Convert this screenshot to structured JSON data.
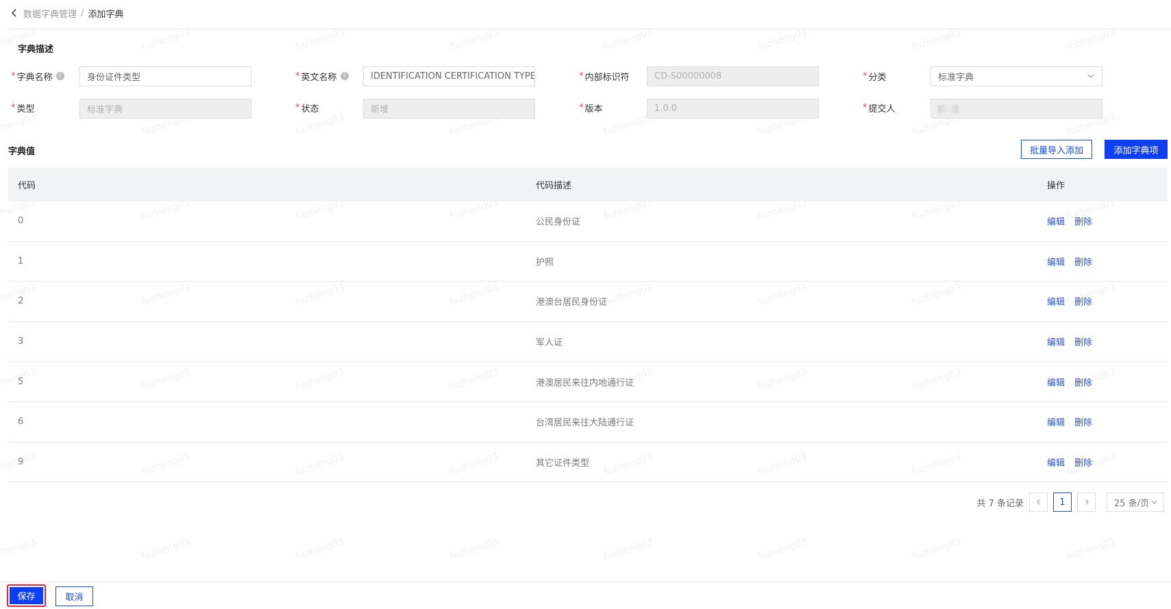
{
  "breadcrumb": {
    "parent": "数据字典管理",
    "separator": "/",
    "current": "添加字典"
  },
  "watermark": "fuzheng03",
  "description_section": {
    "title": "字典描述",
    "fields": {
      "dict_name": {
        "label": "字典名称",
        "value": "身份证件类型"
      },
      "english_name": {
        "label": "英文名称",
        "value": "IDENTIFICATION CERTIFICATION TYPE"
      },
      "internal_id": {
        "label": "内部标识符",
        "value": "CD-S00000008"
      },
      "category": {
        "label": "分类",
        "value": "标准字典"
      },
      "type": {
        "label": "类型",
        "value": "标准字典"
      },
      "status": {
        "label": "状态",
        "value": "新增"
      },
      "version": {
        "label": "版本",
        "value": "1.0.0"
      },
      "submitter": {
        "label": "提交人",
        "value": ""
      }
    },
    "required_mark": "*"
  },
  "values_section": {
    "title": "字典值",
    "batch_import_label": "批量导入添加",
    "add_item_label": "添加字典项",
    "columns": {
      "code": "代码",
      "desc": "代码描述",
      "ops": "操作"
    },
    "rows": [
      {
        "code": "0",
        "desc": "公民身份证",
        "edit": "编辑",
        "delete": "删除"
      },
      {
        "code": "1",
        "desc": "护照",
        "edit": "编辑",
        "delete": "删除"
      },
      {
        "code": "2",
        "desc": "港澳台居民身份证",
        "edit": "编辑",
        "delete": "删除"
      },
      {
        "code": "3",
        "desc": "军人证",
        "edit": "编辑",
        "delete": "删除"
      },
      {
        "code": "5",
        "desc": "港澳居民来往内地通行证",
        "edit": "编辑",
        "delete": "删除"
      },
      {
        "code": "6",
        "desc": "台湾居民来往大陆通行证",
        "edit": "编辑",
        "delete": "删除"
      },
      {
        "code": "9",
        "desc": "其它证件类型",
        "edit": "编辑",
        "delete": "删除"
      }
    ]
  },
  "pagination": {
    "total_text": "共 7 条记录",
    "current_page": "1",
    "page_size": "25 条/页"
  },
  "footer": {
    "save_label": "保存",
    "cancel_label": "取消"
  },
  "colors": {
    "primary": "#0f3ff5",
    "required": "#e34d59",
    "link": "#2f55d8",
    "highlight_border": "#e0243a"
  }
}
